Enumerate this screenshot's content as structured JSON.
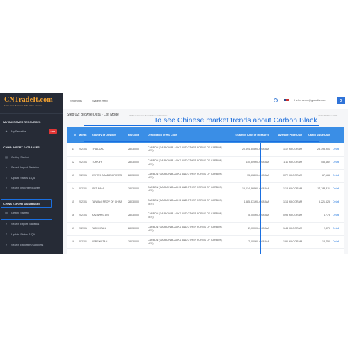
{
  "logo": {
    "title": "CNTradeIt.com",
    "subtitle": "Make Your Business With China Smarter"
  },
  "sidebar": {
    "customer_heading": "MY CUSTOMER RESOURCES",
    "favorites_label": "My Favorites",
    "hot_badge": "HOT",
    "import_heading": "CHINA IMPORT DATABASES",
    "import_items": [
      "Getting Started",
      "Search Import Statistics",
      "Update Status & QA",
      "Search Importers/Buyers"
    ],
    "export_heading": "CHINA EXPORT DATABASES",
    "export_items": [
      "Getting Started",
      "Search Export Statistics",
      "Update Status & QA",
      "Search Exporters/Suppliers"
    ]
  },
  "topbar": {
    "shortcuts": "Shortcuts",
    "system_help": "System Help",
    "user": "Hello, demo@globalia.com",
    "avatar": "D"
  },
  "main": {
    "step_title": "Step 02: Browse Data - List Mode",
    "breadcrumb": "CNTradeIt.com  >  Search Export Statistics",
    "annotation": "To see Chinese market trends about Carbon Black",
    "timestamp": "2022-05-30 16:47:11"
  },
  "table": {
    "headers": [
      "#",
      "Month",
      "Country of Destiny",
      "HS Code",
      "Description of HS Code",
      "Quantity (Unit of Measure)",
      "Average Price USD",
      "Cargo Value USD",
      ""
    ],
    "rows": [
      {
        "n": "11",
        "month": "202101",
        "country": "THAILAND",
        "hs": "28030000",
        "desc": "CARBON (CARBON BLACKS AND OTHER FORMS OF CARBON, NES)",
        "qty": "20,694,805 KILOGRAM",
        "price": "1.12 KILOGRAM",
        "value": "23,398,901",
        "action": "Detail"
      },
      {
        "n": "12",
        "month": "202101",
        "country": "TURKEY",
        "hs": "28030000",
        "desc": "CARBON (CARBON BLACKS AND OTHER FORMS OF CARBON, NES)",
        "qty": "410,809 KILOGRAM",
        "price": "1.11 KILOGRAM",
        "value": "455,462",
        "action": "Detail"
      },
      {
        "n": "13",
        "month": "202101",
        "country": "UNITED ARAB EMIRATES",
        "hs": "28030000",
        "desc": "CARBON (CARBON BLACKS AND OTHER FORMS OF CARBON, NES)",
        "qty": "93,508 KILOGRAM",
        "price": "0.72 KILOGRAM",
        "value": "67,165",
        "action": "Detail"
      },
      {
        "n": "14",
        "month": "202101",
        "country": "VIET NAM",
        "hs": "28030000",
        "desc": "CARBON (CARBON BLACKS AND OTHER FORMS OF CARBON, NES)",
        "qty": "15,014,868 KILOGRAM",
        "price": "1.18 KILOGRAM",
        "value": "17,788,311",
        "action": "Detail"
      },
      {
        "n": "15",
        "month": "202101",
        "country": "TAIWAN, PROV OF CHINA",
        "hs": "28030000",
        "desc": "CARBON (CARBON BLACKS AND OTHER FORMS OF CARBON, NES)",
        "qty": "4,585,871 KILOGRAM",
        "price": "1.14 KILOGRAM",
        "value": "5,221,625",
        "action": "Detail"
      },
      {
        "n": "16",
        "month": "202101",
        "country": "KAZAKHSTAN",
        "hs": "28030000",
        "desc": "CARBON (CARBON BLACKS AND OTHER FORMS OF CARBON, NES)",
        "qty": "5,000 KILOGRAM",
        "price": "0.95 KILOGRAM",
        "value": "4,775",
        "action": "Detail"
      },
      {
        "n": "17",
        "month": "202101",
        "country": "TAJIKISTAN",
        "hs": "28030000",
        "desc": "CARBON (CARBON BLACKS AND OTHER FORMS OF CARBON, NES)",
        "qty": "2,000 KILOGRAM",
        "price": "1.44 KILOGRAM",
        "value": "2,879",
        "action": "Detail"
      },
      {
        "n": "18",
        "month": "202101",
        "country": "UZBEKISTAN",
        "hs": "28030000",
        "desc": "CARBON (CARBON BLACKS AND OTHER FORMS OF CARBON, NES)",
        "qty": "7,000 KILOGRAM",
        "price": "1.96 KILOGRAM",
        "value": "13,750",
        "action": "Detail"
      }
    ]
  },
  "colors": {
    "sidebar_bg": "#262b36",
    "header_blue": "#3a8ee6",
    "highlight": "#1a6fe0",
    "link": "#2f7fe0",
    "logo_orange": "#f0a030"
  }
}
